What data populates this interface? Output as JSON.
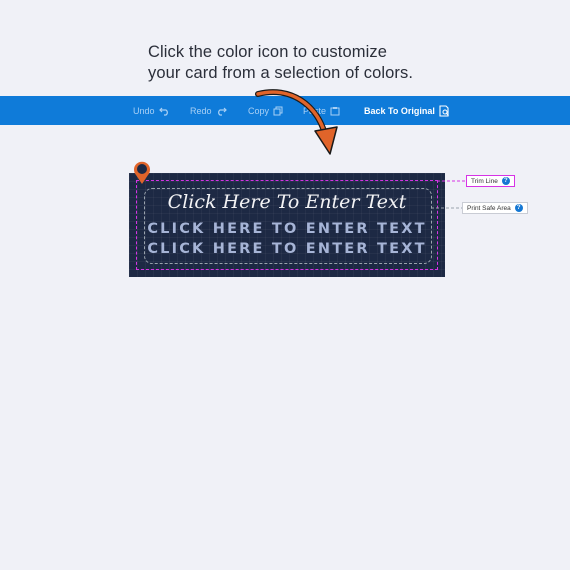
{
  "instruction": {
    "line1": "Click the color icon to customize",
    "line2": "your card from a selection of colors."
  },
  "toolbar": {
    "undo": "Undo",
    "redo": "Redo",
    "copy": "Copy",
    "paste": "Paste",
    "back_to_original": "Back To Original"
  },
  "card": {
    "line1": "Click Here To Enter Text",
    "line2": "CLICK HERE TO ENTER TEXT",
    "line3": "CLICK HERE TO ENTER TEXT"
  },
  "legend": {
    "trim_line": "Trim Line",
    "print_safe_area": "Print Safe Area",
    "help": "?"
  },
  "colors": {
    "toolbar": "#0f7bd9",
    "card_background": "#1d2944",
    "trim_line": "#d633e6",
    "arrow": "#e0642a",
    "pin": "#e0642a"
  }
}
